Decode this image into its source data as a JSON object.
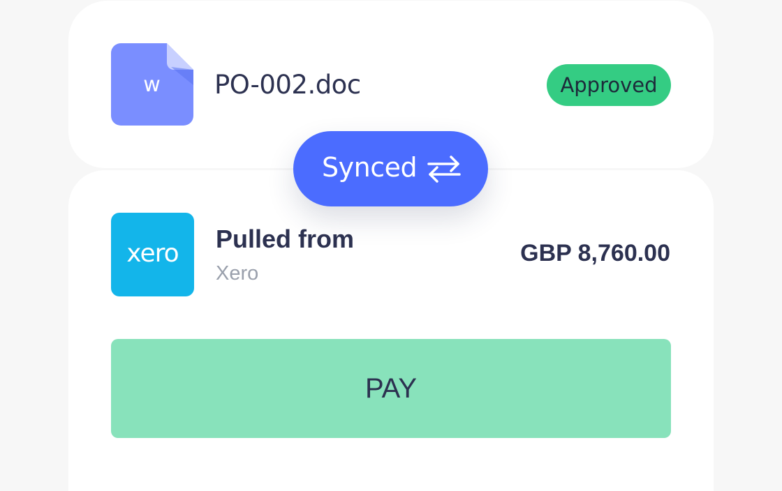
{
  "document": {
    "icon_letter": "w",
    "file_name": "PO-002.doc",
    "status": "Approved",
    "status_color": "#34cc83",
    "icon_color": "#7a8eff"
  },
  "sync": {
    "label": "Synced",
    "icon": "swap-arrows-icon",
    "color": "#4b6cff"
  },
  "source": {
    "logo_text": "xero",
    "logo_color": "#13b5ea",
    "title": "Pulled from",
    "name": "Xero",
    "amount": "GBP 8,760.00"
  },
  "action": {
    "pay_label": "PAY",
    "pay_color": "#88e2bb"
  }
}
